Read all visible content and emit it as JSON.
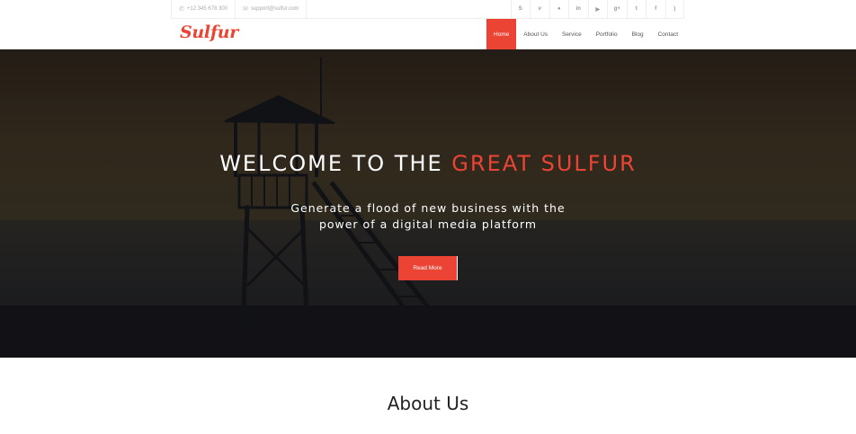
{
  "topbar": {
    "phone": "+12 345 678 300",
    "email": "support@sulfur.com",
    "social": [
      {
        "icon": "skype-icon",
        "glyph": "S"
      },
      {
        "icon": "vimeo-icon",
        "glyph": "v"
      },
      {
        "icon": "flickr-icon",
        "glyph": "●"
      },
      {
        "icon": "linkedin-icon",
        "glyph": "in"
      },
      {
        "icon": "youtube-icon",
        "glyph": "▶"
      },
      {
        "icon": "google-plus-icon",
        "glyph": "g+"
      },
      {
        "icon": "twitter-icon",
        "glyph": "t"
      },
      {
        "icon": "facebook-icon",
        "glyph": "f"
      },
      {
        "icon": "rss-icon",
        "glyph": ")"
      }
    ]
  },
  "nav": {
    "logo": "Sulfur",
    "items": [
      "Home",
      "About Us",
      "Service",
      "Portfolio",
      "Blog",
      "Contact"
    ],
    "active": "Home"
  },
  "hero": {
    "title_start": "WELCOME TO THE ",
    "title_accent": "GREAT SULFUR",
    "subtitle_line1": "Generate a flood of new business with the",
    "subtitle_line2": "power of a digital media platform",
    "button": "Read More"
  },
  "about": {
    "title": "About Us"
  },
  "colors": {
    "accent": "#ec4434"
  }
}
